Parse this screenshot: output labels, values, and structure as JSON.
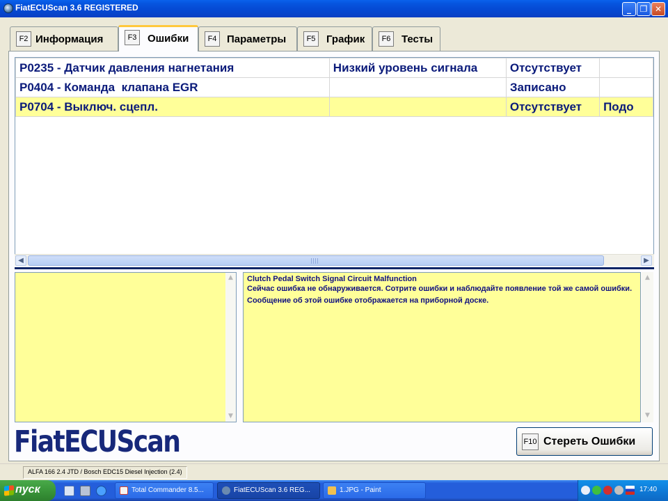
{
  "window": {
    "title": "FiatECUScan 3.6 REGISTERED",
    "minimize": "_",
    "maximize": "❐",
    "close": "✕"
  },
  "tabs": [
    {
      "key": "F2",
      "label": "Информация",
      "active": false
    },
    {
      "key": "F3",
      "label": "Ошибки",
      "active": true
    },
    {
      "key": "F4",
      "label": "Параметры",
      "active": false
    },
    {
      "key": "F5",
      "label": "График",
      "active": false
    },
    {
      "key": "F6",
      "label": "Тесты",
      "active": false
    }
  ],
  "errors": {
    "rows": [
      {
        "code": "P0235 - Датчик давления нагнетания",
        "detail": "Низкий уровень сигнала",
        "status": "Отсутствует",
        "extra": ""
      },
      {
        "code": "P0404 - Команда  клапана EGR",
        "detail": "",
        "status": "Записано",
        "extra": ""
      },
      {
        "code": "P0704 - Выключ. сцепл.",
        "detail": "",
        "status": "Отсутствует",
        "extra": "Подо"
      }
    ],
    "selected_index": 2
  },
  "description": {
    "title": "Clutch Pedal Switch Signal Circuit Malfunction",
    "body": "Сейчас ошибка не обнаруживается. Сотрите ошибки и наблюдайте появление той же самой ошибки. Сообщение об этой ошибке отображается на приборной доске."
  },
  "logo": "FiatECUScan",
  "clear_button": {
    "key": "F10",
    "label": "Стереть Ошибки"
  },
  "status_bar": {
    "vehicle": "ALFA 166 2.4 JTD / Bosch EDC15 Diesel Injection (2.4)"
  },
  "taskbar": {
    "start_label": "пуск",
    "tasks": [
      {
        "label": "Total Commander 8.5...",
        "active": false
      },
      {
        "label": "FiatECUScan 3.6 REG...",
        "active": true
      },
      {
        "label": "1.JPG - Paint",
        "active": false
      }
    ],
    "clock": "17:40"
  },
  "colors": {
    "row_highlight": "#ffff99",
    "text_blue": "#0a1a7a",
    "logo_blue": "#17287a",
    "titlebar_blue": "#0548d2"
  }
}
